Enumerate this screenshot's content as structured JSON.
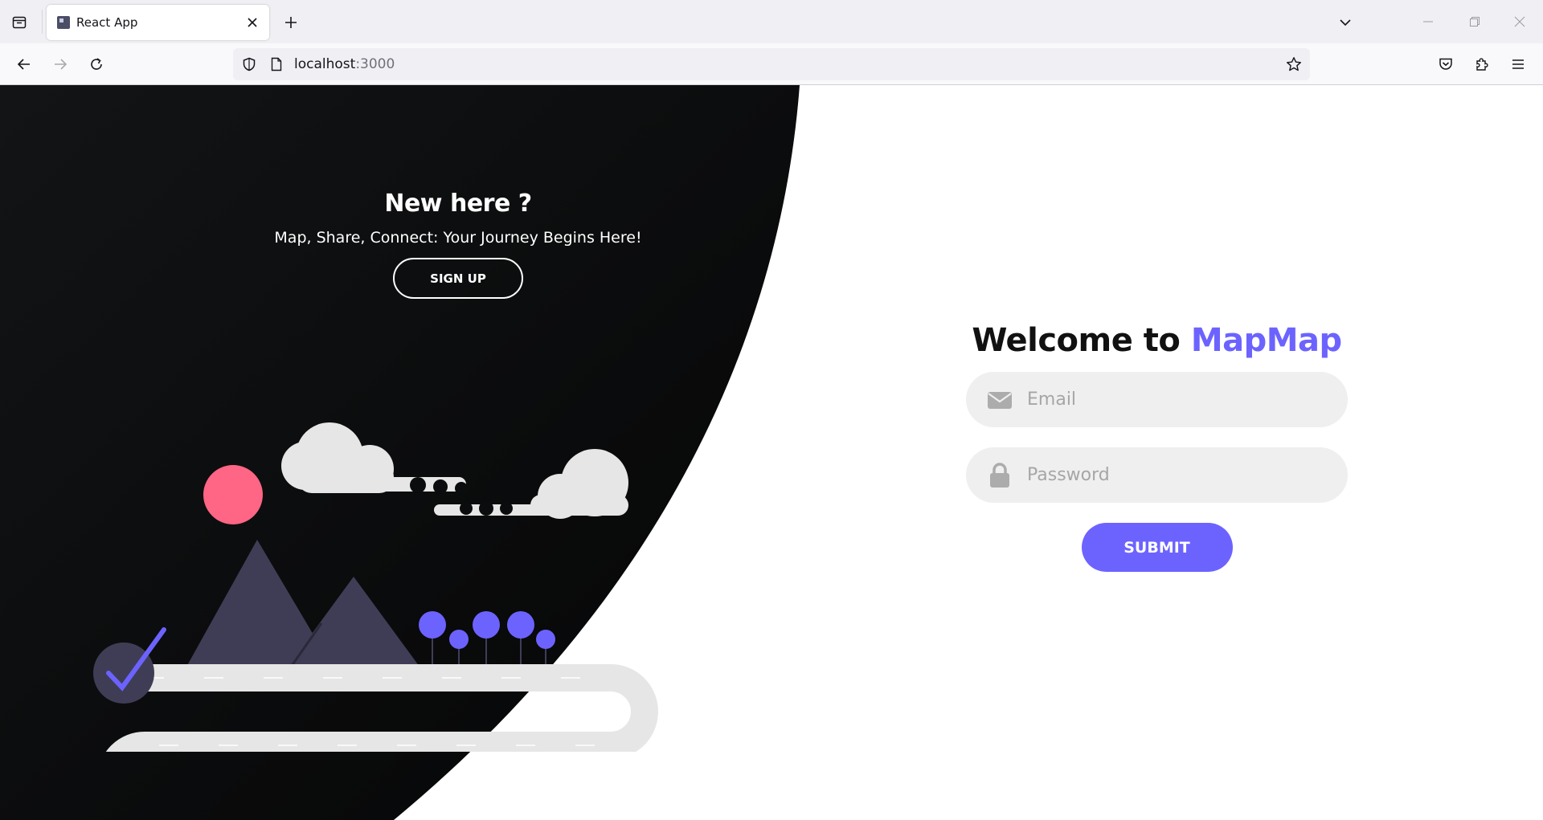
{
  "browser": {
    "tab_title": "React App",
    "url_host": "localhost",
    "url_port": ":3000"
  },
  "signup_panel": {
    "heading": "New here ?",
    "subtitle": "Map, Share, Connect: Your Journey Begins Here!",
    "button_label": "SIGN UP"
  },
  "signin_form": {
    "title_prefix": "Welcome to ",
    "title_brand": "MapMap",
    "email_placeholder": "Email",
    "password_placeholder": "Password",
    "submit_label": "SUBMIT"
  },
  "colors": {
    "accent": "#6c63ff",
    "dark_panel": "#0a0b0c",
    "input_bg": "#efefef",
    "sun": "#ff6584",
    "mountain": "#3f3d56",
    "road": "#e6e6e6"
  }
}
